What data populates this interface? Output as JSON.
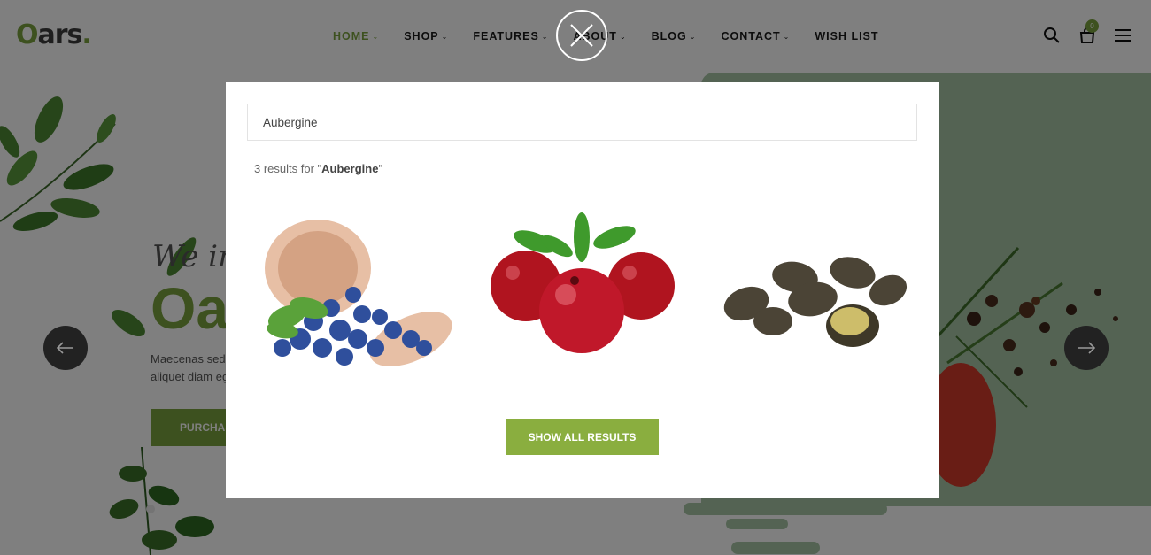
{
  "brand": {
    "logo_o": "O",
    "logo_rest": "ars",
    "logo_dot": "."
  },
  "nav": {
    "items": [
      {
        "label": "HOME",
        "has_dropdown": true,
        "active": true
      },
      {
        "label": "SHOP",
        "has_dropdown": true
      },
      {
        "label": "FEATURES",
        "has_dropdown": true
      },
      {
        "label": "ABOUT",
        "has_dropdown": true
      },
      {
        "label": "BLOG",
        "has_dropdown": true
      },
      {
        "label": "CONTACT",
        "has_dropdown": true
      },
      {
        "label": "WISH LIST",
        "has_dropdown": false
      }
    ],
    "chevron": "⌄"
  },
  "header_icons": {
    "search": "search-icon",
    "cart": "cart-icon",
    "cart_count": "0",
    "menu": "hamburger-menu-icon"
  },
  "hero": {
    "script": "We in",
    "title": "Oa",
    "text_line1": "Maecenas sed",
    "text_line2": "aliquet diam eg",
    "button": "PURCHASE"
  },
  "search_modal": {
    "query": "Aubergine",
    "results_prefix": "3 results for \"",
    "results_term": "Aubergine",
    "results_suffix": "\"",
    "products": [
      {
        "name": "blueberries-in-wooden-bowl"
      },
      {
        "name": "cranberries-with-leaves"
      },
      {
        "name": "dried-nuts"
      }
    ],
    "show_all_label": "SHOW ALL RESULTS"
  },
  "colors": {
    "accent": "#7ba23f",
    "button": "#8aae3f",
    "green_panel": "#a9c7a7",
    "overlay": "rgba(0,0,0,0.5)"
  }
}
